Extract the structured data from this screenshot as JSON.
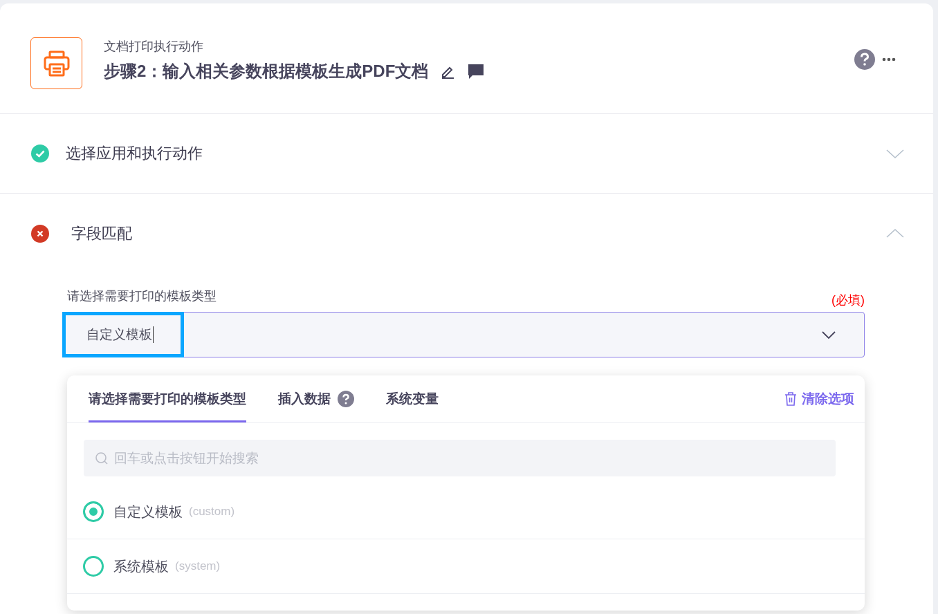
{
  "header": {
    "subtitle": "文档打印执行动作",
    "title": "步骤2：输入相关参数根据模板生成PDF文档"
  },
  "sections": [
    {
      "title": "选择应用和执行动作",
      "valid": true,
      "expanded": false
    },
    {
      "title": "字段匹配",
      "valid": false,
      "expanded": true
    }
  ],
  "field": {
    "label": "请选择需要打印的模板类型",
    "required_note": "(必填)",
    "value": "自定义模板",
    "focused": true
  },
  "dropdown": {
    "tabs": [
      {
        "label": "请选择需要打印的模板类型",
        "selected": true,
        "help": false
      },
      {
        "label": "插入数据",
        "selected": false,
        "help": true
      },
      {
        "label": "系统变量",
        "selected": false,
        "help": false
      }
    ],
    "clear_button": "清除选项",
    "search": {
      "placeholder": "回车或点击按钮开始搜索"
    },
    "options": [
      {
        "label": "自定义模板",
        "hint": "(custom)",
        "selected": true
      },
      {
        "label": "系统模板",
        "hint": "(system)",
        "selected": false
      }
    ]
  }
}
